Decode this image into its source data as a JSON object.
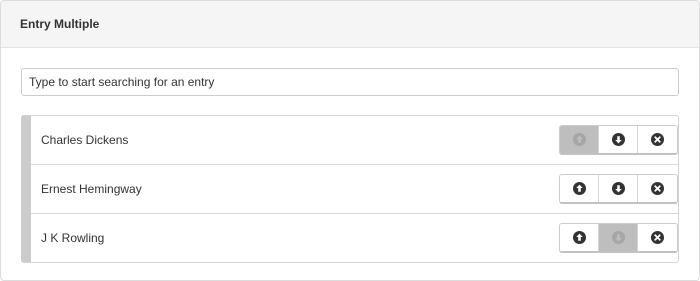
{
  "panel": {
    "title": "Entry Multiple"
  },
  "search": {
    "placeholder": "Type to start searching for an entry"
  },
  "entries": [
    {
      "label": "Charles Dickens",
      "actions": {
        "up": {
          "icon": "arrow-up-circle-icon",
          "enabled": false
        },
        "down": {
          "icon": "arrow-down-circle-icon",
          "enabled": true
        },
        "remove": {
          "icon": "close-circle-icon",
          "enabled": true
        }
      }
    },
    {
      "label": "Ernest Hemingway",
      "actions": {
        "up": {
          "icon": "arrow-up-circle-icon",
          "enabled": true
        },
        "down": {
          "icon": "arrow-down-circle-icon",
          "enabled": true
        },
        "remove": {
          "icon": "close-circle-icon",
          "enabled": true
        }
      }
    },
    {
      "label": "J K Rowling",
      "actions": {
        "up": {
          "icon": "arrow-up-circle-icon",
          "enabled": true
        },
        "down": {
          "icon": "arrow-down-circle-icon",
          "enabled": false
        },
        "remove": {
          "icon": "close-circle-icon",
          "enabled": true
        }
      }
    }
  ],
  "colors": {
    "header_bg": "#f5f5f5",
    "list_accent": "#cccccc",
    "disabled_button_bg": "#bebebe",
    "icon_dark": "#333333",
    "icon_disabled": "#a6a6a6"
  }
}
